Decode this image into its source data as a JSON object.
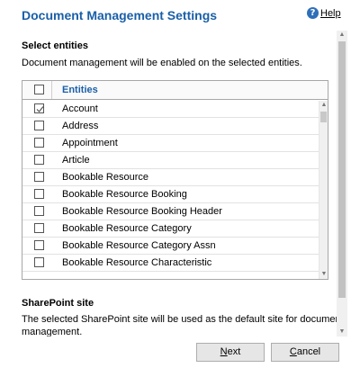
{
  "header": {
    "title": "Document Management Settings",
    "help_label": "Help",
    "help_icon": "help-icon"
  },
  "entities_section": {
    "title": "Select entities",
    "description": "Document management will be enabled on the selected entities."
  },
  "grid": {
    "header_label": "Entities",
    "rows": [
      {
        "label": "Account",
        "checked": true
      },
      {
        "label": "Address",
        "checked": false
      },
      {
        "label": "Appointment",
        "checked": false
      },
      {
        "label": "Article",
        "checked": false
      },
      {
        "label": "Bookable Resource",
        "checked": false
      },
      {
        "label": "Bookable Resource Booking",
        "checked": false
      },
      {
        "label": "Bookable Resource Booking Header",
        "checked": false
      },
      {
        "label": "Bookable Resource Category",
        "checked": false
      },
      {
        "label": "Bookable Resource Category Assn",
        "checked": false
      },
      {
        "label": "Bookable Resource Characteristic",
        "checked": false
      }
    ]
  },
  "sharepoint_section": {
    "title": "SharePoint site",
    "description_line1": "The selected SharePoint site will be used as the default site for document",
    "description_line2": "management."
  },
  "footer": {
    "next_first": "N",
    "next_rest": "ext",
    "cancel_first": "C",
    "cancel_rest": "ancel"
  },
  "colors": {
    "accent": "#1a5fa8",
    "help_icon_bg": "#2f6fb9",
    "button_bg": "#e6e6e6"
  }
}
